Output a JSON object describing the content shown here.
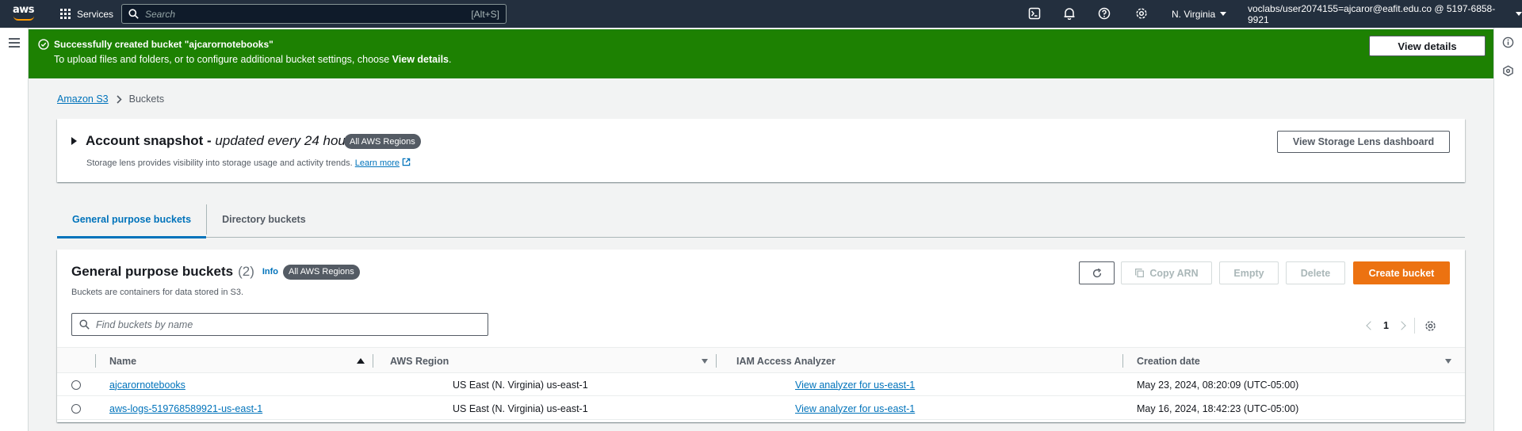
{
  "topnav": {
    "logo_text": "aws",
    "services_label": "Services",
    "search_placeholder": "Search",
    "search_shortcut": "[Alt+S]",
    "region": "N. Virginia",
    "account": "voclabs/user2074155=ajcaror@eafit.edu.co @ 5197-6858-9921"
  },
  "flash": {
    "title": "Successfully created bucket \"ajcarornotebooks\"",
    "message_prefix": "To upload files and folders, or to configure additional bucket settings, choose ",
    "message_link": "View details",
    "message_suffix": ".",
    "button_label": "View details",
    "color": "#1d8102"
  },
  "breadcrumb": {
    "root": "Amazon S3",
    "current": "Buckets"
  },
  "snapshot": {
    "title": "Account snapshot - ",
    "title_italic": "updated every 24 hours",
    "badge": "All AWS Regions",
    "description": "Storage lens provides visibility into storage usage and activity trends.",
    "learn_more": "Learn more",
    "button_label": "View Storage Lens dashboard"
  },
  "tabs": [
    {
      "label": "General purpose buckets",
      "active": true
    },
    {
      "label": "Directory buckets",
      "active": false
    }
  ],
  "buckets": {
    "title": "General purpose buckets",
    "count": "(2)",
    "info": "Info",
    "badge": "All AWS Regions",
    "description": "Buckets are containers for data stored in S3.",
    "buttons": {
      "copy_arn": "Copy ARN",
      "empty": "Empty",
      "delete": "Delete",
      "create": "Create bucket"
    },
    "filter_placeholder": "Find buckets by name",
    "page": "1",
    "columns": {
      "name": "Name",
      "region": "AWS Region",
      "analyzer": "IAM Access Analyzer",
      "created": "Creation date"
    },
    "rows": [
      {
        "name": "ajcarornotebooks",
        "region": "US East (N. Virginia) us-east-1",
        "analyzer": "View analyzer for us-east-1",
        "created": "May 23, 2024, 08:20:09 (UTC-05:00)"
      },
      {
        "name": "aws-logs-519768589921-us-east-1",
        "region": "US East (N. Virginia) us-east-1",
        "analyzer": "View analyzer for us-east-1",
        "created": "May 16, 2024, 18:42:23 (UTC-05:00)"
      }
    ],
    "accent_color": "#ec7211"
  }
}
